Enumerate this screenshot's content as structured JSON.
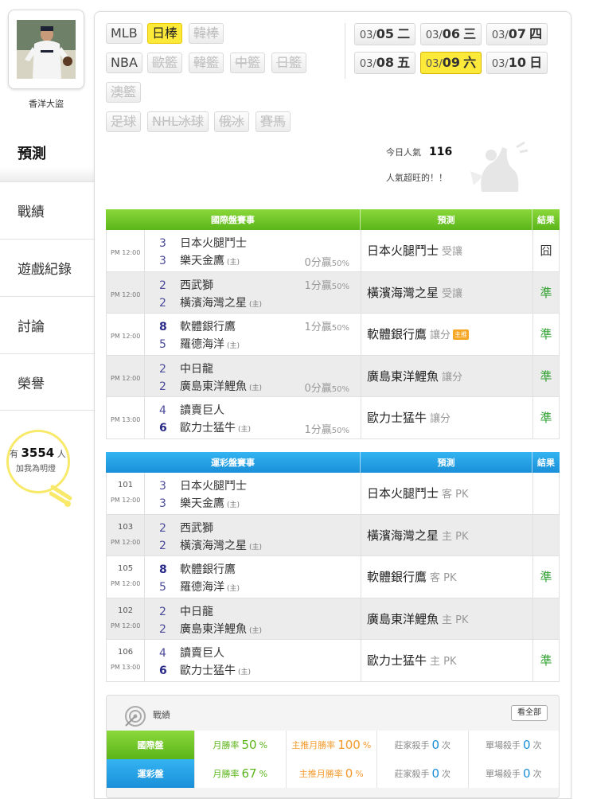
{
  "user": {
    "name": "香洋大盜"
  },
  "nav": [
    {
      "label": "預測",
      "active": true
    },
    {
      "label": "戰績"
    },
    {
      "label": "遊戲紀錄"
    },
    {
      "label": "討論"
    },
    {
      "label": "榮譽"
    }
  ],
  "fans": {
    "prefix": "有",
    "count": "3554",
    "suffix": "人",
    "line2": "加我為明燈"
  },
  "sports": {
    "row1": [
      {
        "label": "MLB",
        "state": "normal"
      },
      {
        "label": "日棒",
        "state": "selected"
      },
      {
        "label": "韓棒",
        "state": "disabled"
      }
    ],
    "row2": [
      {
        "label": "NBA",
        "state": "normal"
      },
      {
        "label": "歐籃",
        "state": "disabled"
      },
      {
        "label": "韓籃",
        "state": "disabled"
      },
      {
        "label": "中籃",
        "state": "disabled"
      },
      {
        "label": "日籃",
        "state": "disabled"
      }
    ],
    "row3": [
      {
        "label": "澳籃",
        "state": "disabled"
      }
    ],
    "row4": [
      {
        "label": "足球",
        "state": "disabled"
      },
      {
        "label": "NHL冰球",
        "state": "disabled"
      },
      {
        "label": "俄冰",
        "state": "disabled"
      },
      {
        "label": "賽馬",
        "state": "disabled"
      }
    ]
  },
  "dates": [
    {
      "md": "03/",
      "day": "05",
      "wd": "二",
      "selected": false
    },
    {
      "md": "03/",
      "day": "06",
      "wd": "三",
      "selected": false
    },
    {
      "md": "03/",
      "day": "07",
      "wd": "四",
      "selected": false
    },
    {
      "md": "03/",
      "day": "08",
      "wd": "五",
      "selected": false
    },
    {
      "md": "03/",
      "day": "09",
      "wd": "六",
      "selected": true
    },
    {
      "md": "03/",
      "day": "10",
      "wd": "日",
      "selected": false
    }
  ],
  "popularity": {
    "label": "今日人氣",
    "value": "116",
    "note": "人氣超旺的！！"
  },
  "intl": {
    "headers": [
      "國際盤賽事",
      "預測",
      "結果"
    ],
    "rows": [
      {
        "time": "PM 12:00",
        "s1": "3",
        "t1": "日本火腿鬥士",
        "h1": "",
        "s2": "3",
        "t2": "樂天金鷹",
        "h2": "(主)",
        "odds_top": "",
        "odds_bot": "0分贏",
        "pct_top": "",
        "pct_bot": "50%",
        "pred": "日本火腿鬥士",
        "pred_sub": "受讓",
        "badge": "",
        "result": "囧",
        "rclass": "res-push",
        "bold1": false,
        "bold2": false
      },
      {
        "time": "PM 12:00",
        "s1": "2",
        "t1": "西武獅",
        "h1": "",
        "s2": "2",
        "t2": "橫濱海灣之星",
        "h2": "(主)",
        "odds_top": "1分贏",
        "odds_bot": "",
        "pct_top": "50%",
        "pct_bot": "",
        "pred": "橫濱海灣之星",
        "pred_sub": "受讓",
        "badge": "",
        "result": "準",
        "rclass": "res-win",
        "bold1": false,
        "bold2": false
      },
      {
        "time": "PM 12:00",
        "s1": "8",
        "t1": "軟體銀行鷹",
        "h1": "",
        "s2": "5",
        "t2": "羅德海洋",
        "h2": "(主)",
        "odds_top": "1分贏",
        "odds_bot": "",
        "pct_top": "50%",
        "pct_bot": "",
        "pred": "軟體銀行鷹",
        "pred_sub": "讓分",
        "badge": "主推",
        "result": "準",
        "rclass": "res-win",
        "bold1": true,
        "bold2": false
      },
      {
        "time": "PM 12:00",
        "s1": "2",
        "t1": "中日龍",
        "h1": "",
        "s2": "2",
        "t2": "廣島東洋鯉魚",
        "h2": "(主)",
        "odds_top": "",
        "odds_bot": "0分贏",
        "pct_top": "",
        "pct_bot": "50%",
        "pred": "廣島東洋鯉魚",
        "pred_sub": "讓分",
        "badge": "",
        "result": "準",
        "rclass": "res-win",
        "bold1": false,
        "bold2": false
      },
      {
        "time": "PM 13:00",
        "s1": "4",
        "t1": "讀賣巨人",
        "h1": "",
        "s2": "6",
        "t2": "歐力士猛牛",
        "h2": "(主)",
        "odds_top": "",
        "odds_bot": "1分贏",
        "pct_top": "",
        "pct_bot": "50%",
        "pred": "歐力士猛牛",
        "pred_sub": "讓分",
        "badge": "",
        "result": "準",
        "rclass": "res-win",
        "bold1": false,
        "bold2": true
      }
    ]
  },
  "lottery": {
    "headers": [
      "運彩盤賽事",
      "預測",
      "結果"
    ],
    "rows": [
      {
        "code": "101",
        "time": "PM 12:00",
        "s1": "3",
        "t1": "日本火腿鬥士",
        "s2": "3",
        "t2": "樂天金鷹",
        "h2": "(主)",
        "pred": "日本火腿鬥士",
        "pred_sub": "客 PK",
        "result": "",
        "bold1": false,
        "bold2": false
      },
      {
        "code": "103",
        "time": "PM 12:00",
        "s1": "2",
        "t1": "西武獅",
        "s2": "2",
        "t2": "橫濱海灣之星",
        "h2": "(主)",
        "pred": "橫濱海灣之星",
        "pred_sub": "主 PK",
        "result": "",
        "bold1": false,
        "bold2": false
      },
      {
        "code": "105",
        "time": "PM 12:00",
        "s1": "8",
        "t1": "軟體銀行鷹",
        "s2": "5",
        "t2": "羅德海洋",
        "h2": "(主)",
        "pred": "軟體銀行鷹",
        "pred_sub": "客 PK",
        "result": "準",
        "bold1": true,
        "bold2": false
      },
      {
        "code": "102",
        "time": "PM 12:00",
        "s1": "2",
        "t1": "中日龍",
        "s2": "2",
        "t2": "廣島東洋鯉魚",
        "h2": "(主)",
        "pred": "廣島東洋鯉魚",
        "pred_sub": "主 PK",
        "result": "",
        "bold1": false,
        "bold2": false
      },
      {
        "code": "106",
        "time": "PM 13:00",
        "s1": "4",
        "t1": "讀賣巨人",
        "s2": "6",
        "t2": "歐力士猛牛",
        "h2": "(主)",
        "pred": "歐力士猛牛",
        "pred_sub": "主 PK",
        "result": "準",
        "bold1": false,
        "bold2": true
      }
    ]
  },
  "summary": {
    "title": "戰績",
    "all_button": "看全部",
    "rows": [
      {
        "label": "國際盤",
        "color": "green",
        "monthly_label": "月勝率",
        "monthly": "50",
        "main_label": "主推月勝率",
        "main": "100",
        "dealer_label": "莊家殺手",
        "dealer": "0",
        "single_label": "單場殺手",
        "single": "0",
        "pct": "%",
        "times": "次"
      },
      {
        "label": "運彩盤",
        "color": "blue",
        "monthly_label": "月勝率",
        "monthly": "67",
        "main_label": "主推月勝率",
        "main": "0",
        "dealer_label": "莊家殺手",
        "dealer": "0",
        "single_label": "單場殺手",
        "single": "0",
        "pct": "%",
        "times": "次"
      }
    ]
  },
  "colors": {
    "green": "#5bb51a",
    "blue": "#1a8fd8",
    "yellow": "#fde93a",
    "orange": "#f39a2c"
  }
}
